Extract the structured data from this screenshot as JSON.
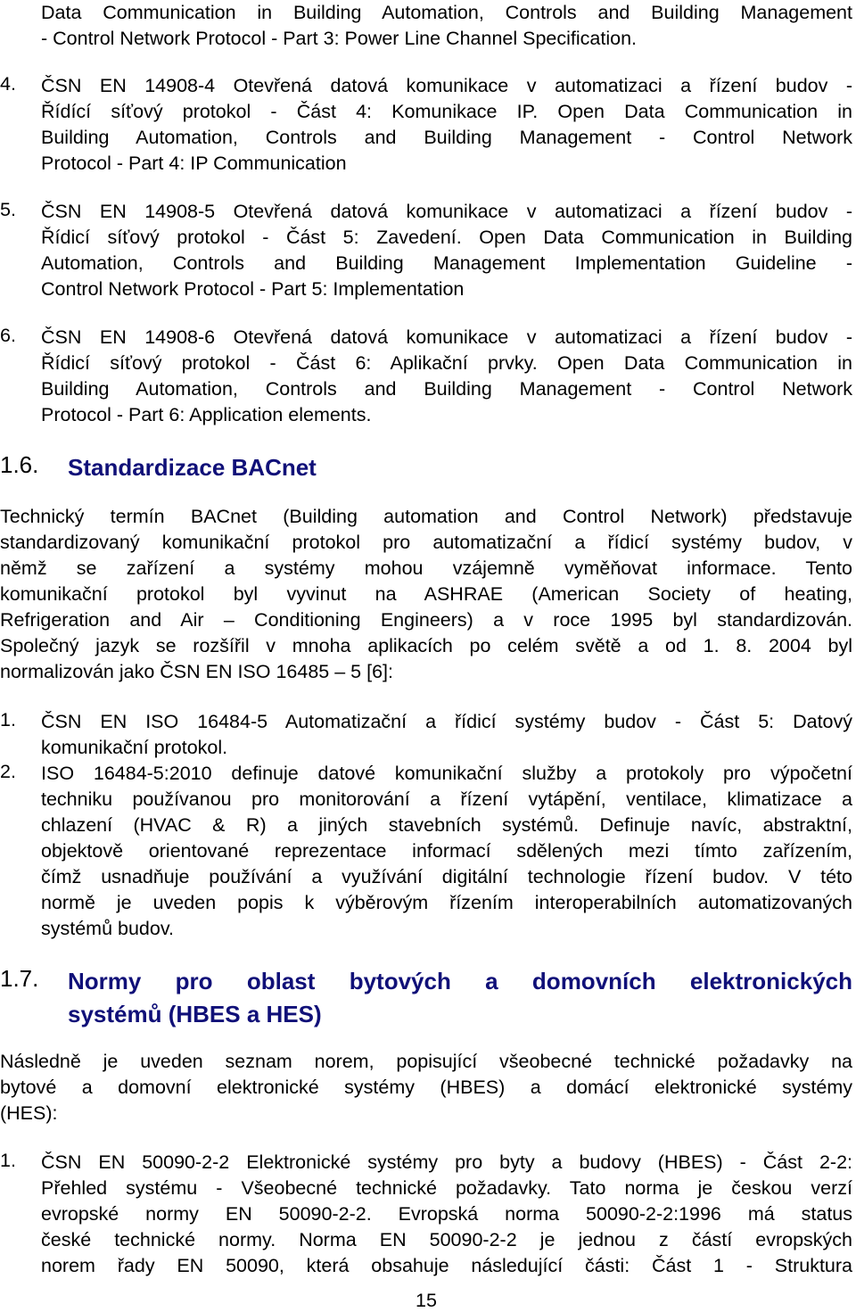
{
  "top_continuation": {
    "lines": [
      "Data Communication in Building Automation, Controls and Building Management",
      "- Control Network Protocol - Part 3: Power Line Channel Specification."
    ]
  },
  "list_14908": [
    {
      "number": "4.",
      "lines": [
        "ČSN EN 14908-4 Otevřená datová komunikace v automatizaci a řízení budov -",
        "Řídící síťový protokol - Část 4: Komunikace IP. Open Data Communication in",
        "Building Automation, Controls and Building Management - Control Network",
        "Protocol - Part 4: IP Communication"
      ]
    },
    {
      "number": "5.",
      "lines": [
        "ČSN EN 14908-5 Otevřená datová komunikace v automatizaci a řízení budov -",
        "Řídicí síťový protokol - Část 5: Zavedení. Open Data Communication in Building",
        "Automation, Controls and Building Management Implementation Guideline -",
        "Control Network Protocol - Part 5: Implementation"
      ]
    },
    {
      "number": "6.",
      "lines": [
        "ČSN EN 14908-6 Otevřená datová komunikace v automatizaci a řízení budov -",
        "Řídicí síťový protokol - Část 6: Aplikační prvky. Open Data Communication in",
        "Building Automation, Controls and Building Management - Control Network",
        "Protocol - Part 6: Application elements."
      ]
    }
  ],
  "section_16": {
    "number": "1.6.",
    "title": "Standardizace BACnet",
    "paragraph_lines": [
      "Technický termín BACnet (Building automation and Control Network) představuje",
      "standardizovaný komunikační protokol pro automatizační a řídicí systémy budov, v",
      "němž se zařízení a systémy mohou vzájemně vyměňovat informace. Tento",
      "komunikační protokol byl vyvinut na ASHRAE (American Society of heating,",
      "Refrigeration and Air – Conditioning Engineers) a v roce 1995 byl standardizován.",
      "Společný jazyk se rozšířil v mnoha aplikacích po celém světě a od 1. 8. 2004 byl",
      "normalizován jako ČSN EN ISO 16485 – 5 [6]:"
    ],
    "list": [
      {
        "number": "1.",
        "lines": [
          "ČSN EN ISO 16484-5 Automatizační a řídicí systémy budov - Část 5: Datový",
          "komunikační protokol."
        ]
      },
      {
        "number": "2.",
        "lines": [
          "ISO 16484-5:2010 definuje datové komunikační služby a protokoly pro výpočetní",
          "techniku používanou pro monitorování a řízení vytápění, ventilace, klimatizace a",
          "chlazení (HVAC & R) a jiných stavebních systémů. Definuje navíc, abstraktní,",
          "objektově orientované reprezentace informací sdělených mezi tímto zařízením,",
          "čímž usnadňuje používání a využívání digitální technologie řízení budov. V této",
          "normě je uveden popis k výběrovým řízením interoperabilních automatizovaných",
          "systémů budov."
        ]
      }
    ]
  },
  "section_17": {
    "number": "1.7.",
    "title_lines": [
      "Normy pro oblast bytových a domovních elektronických",
      "systémů (HBES a HES)"
    ],
    "paragraph_lines": [
      "Následně je uveden seznam norem, popisující všeobecné technické požadavky na",
      "bytové a domovní elektronické systémy (HBES) a domácí elektronické systémy",
      "(HES):"
    ],
    "list": [
      {
        "number": "1.",
        "lines": [
          "ČSN EN 50090-2-2 Elektronické systémy pro byty a budovy (HBES) - Část 2-2:",
          "Přehled systému - Všeobecné technické požadavky. Tato norma je českou verzí",
          "evropské normy EN 50090-2-2. Evropská norma 50090-2-2:1996 má status",
          "české technické normy. Norma EN 50090-2-2 je jednou z částí evropských",
          "norem řady EN 50090, která obsahuje následující části: Část 1 - Struktura"
        ]
      }
    ]
  },
  "page_number": "15",
  "colors": {
    "heading": "#101078",
    "text": "#000000",
    "background": "#ffffff"
  }
}
